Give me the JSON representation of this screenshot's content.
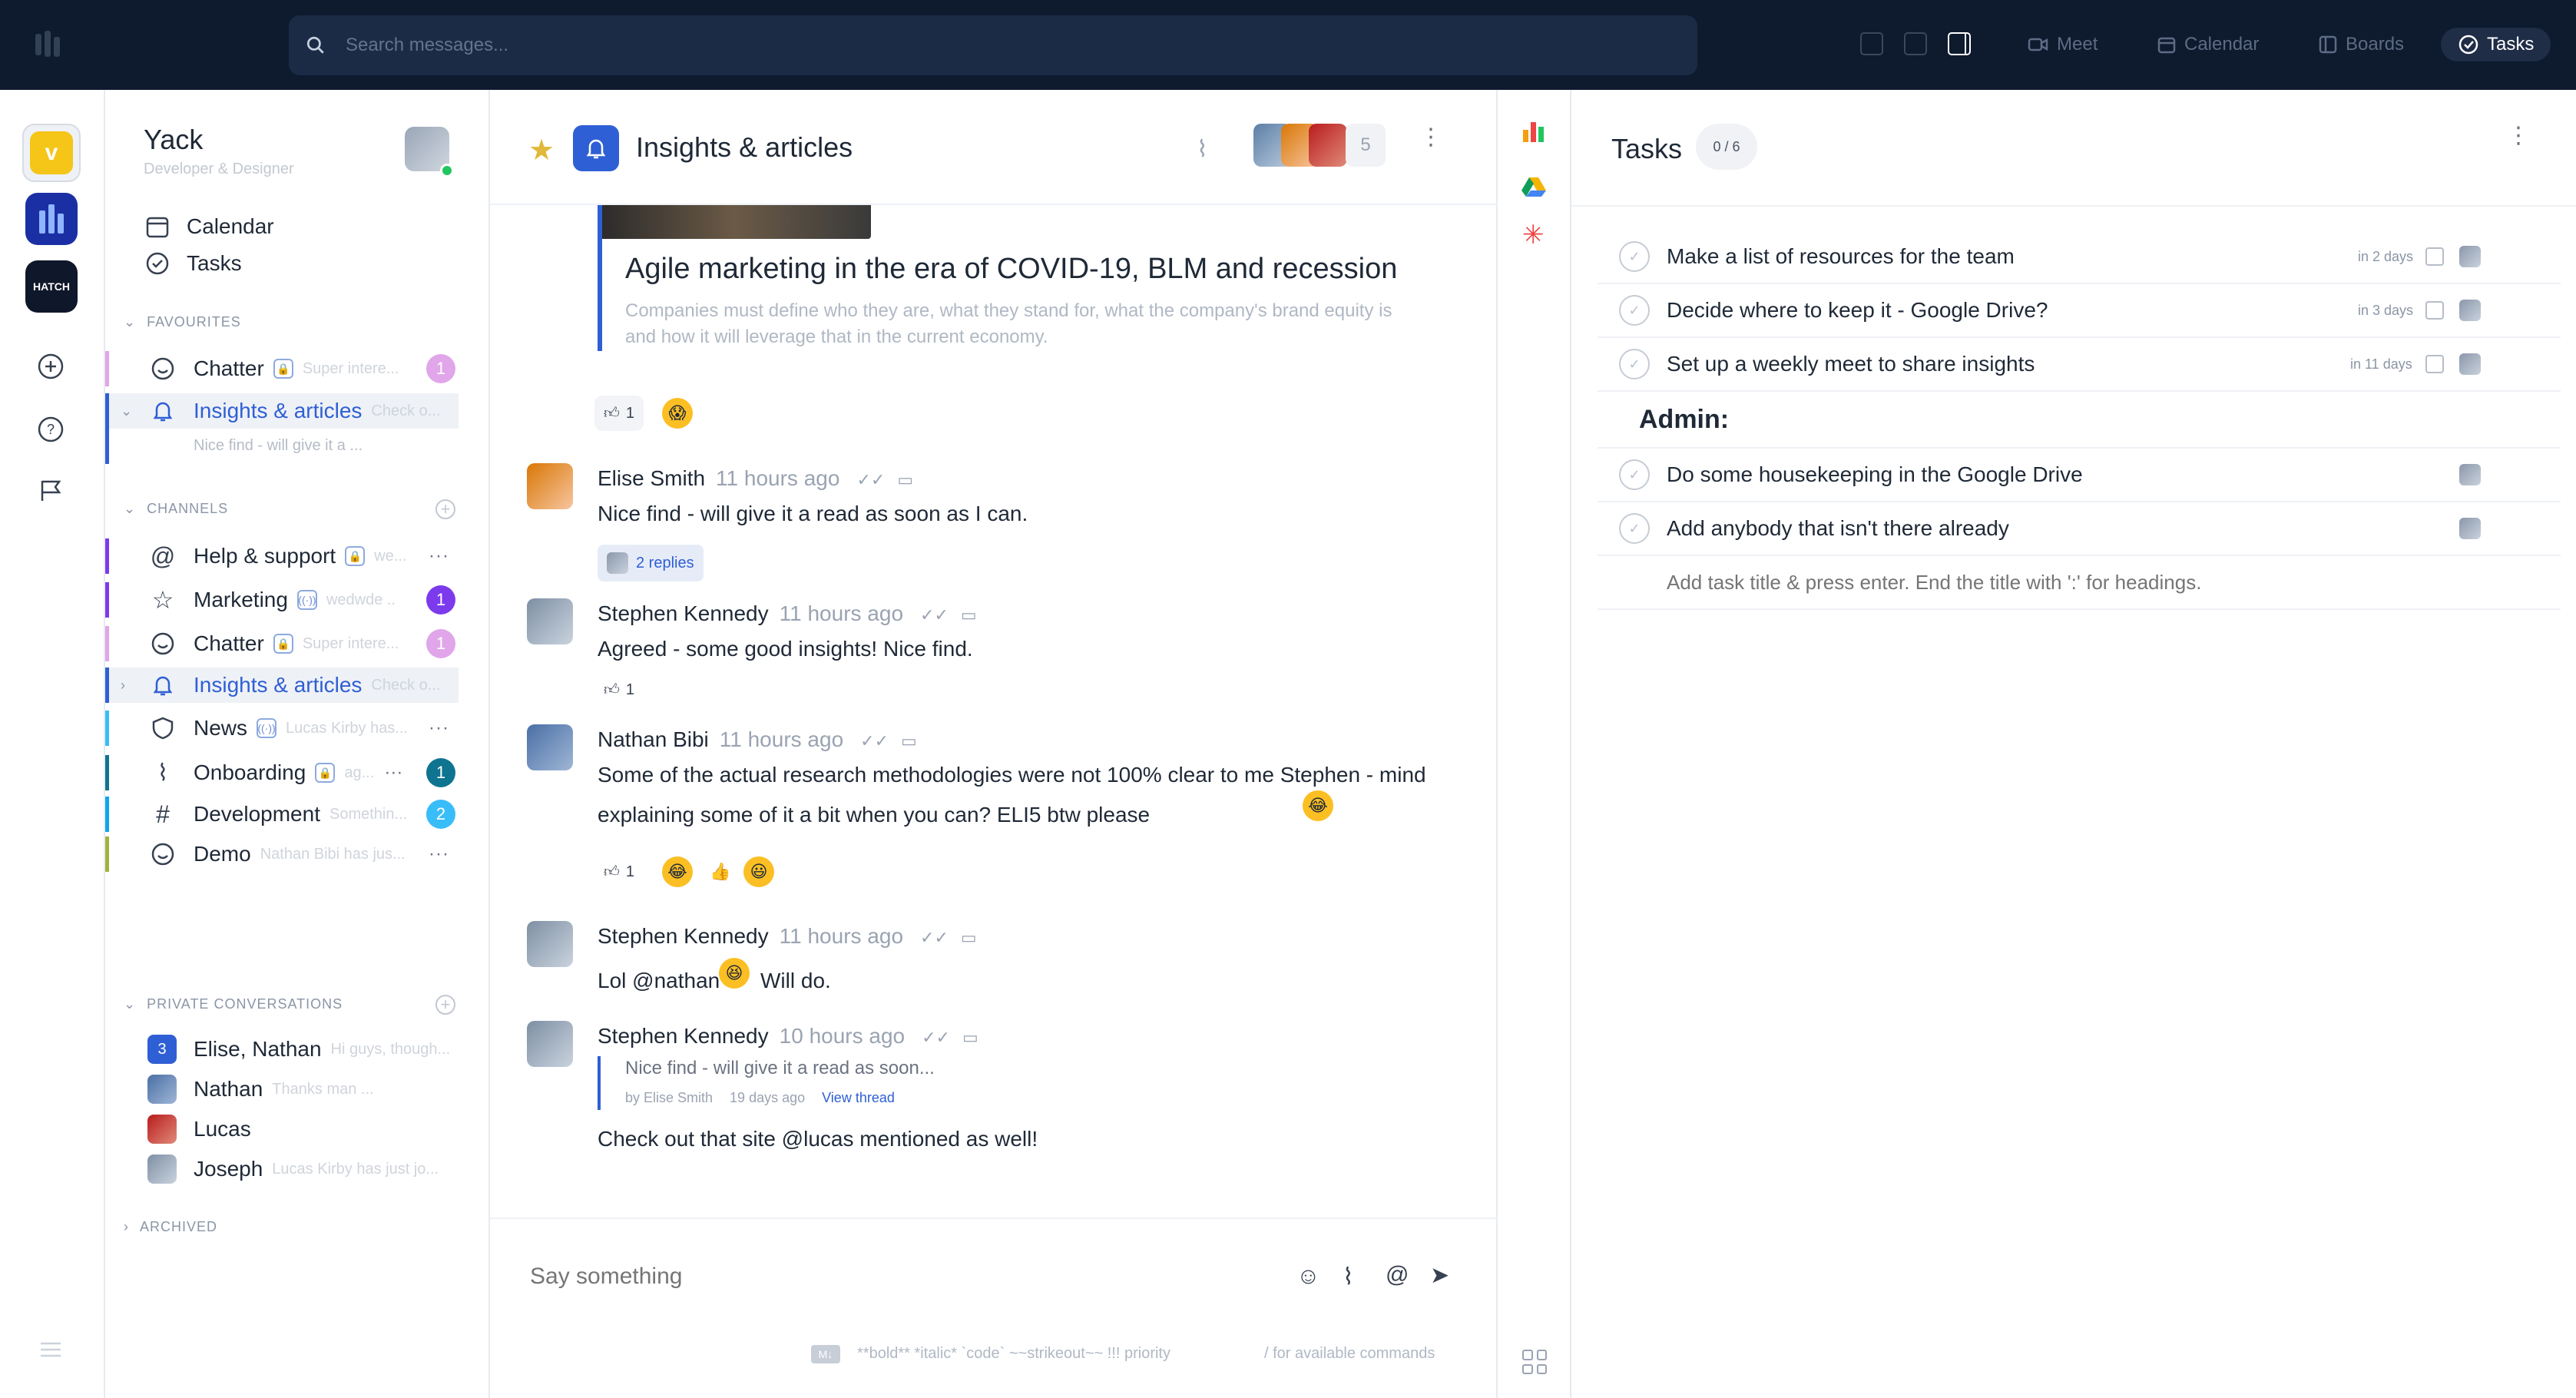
{
  "topbar": {
    "search_placeholder": "Search messages...",
    "nav": [
      {
        "label": "Meet",
        "icon": "video-icon"
      },
      {
        "label": "Calendar",
        "icon": "calendar-icon"
      },
      {
        "label": "Boards",
        "icon": "boards-icon"
      },
      {
        "label": "Tasks",
        "icon": "check-circle-icon",
        "active": true
      }
    ]
  },
  "rail": {
    "workspaces": [
      "Yack",
      "Hatch workspace",
      "HATCH"
    ]
  },
  "sidebar": {
    "team_name": "Yack",
    "subtitle": "Developer & Designer",
    "links": [
      {
        "label": "Calendar"
      },
      {
        "label": "Tasks"
      }
    ],
    "favourites_label": "FAVOURITES",
    "favourites": [
      {
        "name": "Chatter",
        "preview": "Super intere...",
        "badge": "1"
      },
      {
        "name": "Insights & articles",
        "preview": "Check o...",
        "subpreview": "Nice find - will give it a ..."
      }
    ],
    "channels_label": "CHANNELS",
    "channels": [
      {
        "name": "Help & support",
        "preview": "we...",
        "bar": "#7c3aed"
      },
      {
        "name": "Marketing",
        "preview": "wedwde ...",
        "badge": "1",
        "bar": "#7c3aed"
      },
      {
        "name": "Chatter",
        "preview": "Super intere...",
        "badge": "1",
        "bar": "#e0a6e9"
      },
      {
        "name": "Insights & articles",
        "preview": "Check o...",
        "bar": "#2f5fd4"
      },
      {
        "name": "News",
        "preview": "Lucas Kirby has...",
        "bar": "#38bdf8"
      },
      {
        "name": "Onboarding",
        "preview": "ag...",
        "badge": "1",
        "bar": "#0e7490"
      },
      {
        "name": "Development",
        "preview": "Somethin...",
        "badge": "2",
        "bar": "#0ea5e9"
      },
      {
        "name": "Demo",
        "preview": "Nathan Bibi has jus...",
        "bar": "#a3b13c"
      }
    ],
    "private_label": "PRIVATE CONVERSATIONS",
    "private": [
      {
        "name": "Elise, Nathan",
        "preview": "Hi guys, though...",
        "count": "3"
      },
      {
        "name": "Nathan",
        "preview": "Thanks man ..."
      },
      {
        "name": "Lucas",
        "preview": ""
      },
      {
        "name": "Joseph",
        "preview": "Lucas Kirby has just jo..."
      }
    ],
    "archived_label": "ARCHIVED"
  },
  "channel": {
    "title": "Insights & articles",
    "member_count": "5",
    "article_title": "Agile marketing in the era of COVID-19, BLM and recession",
    "article_desc_1": "Companies must define who they are, what they stand for, what the company's brand equity is",
    "article_desc_2": "and how it will leverage that in the current economy.",
    "article_likes": "1"
  },
  "messages": [
    {
      "author": "Elise Smith",
      "time": "11 hours ago",
      "text": "Nice find - will give it a read as soon as I can.",
      "replies": "2 replies"
    },
    {
      "author": "Stephen Kennedy",
      "time": "11 hours ago",
      "text": "Agreed - some good insights! Nice find.",
      "likes": "1"
    },
    {
      "author": "Nathan Bibi",
      "time": "11 hours ago",
      "text_1": "Some of the actual research methodologies were not 100% clear to me Stephen - mind",
      "text_2": "explaining some of it a bit when you can? ELI5 btw please",
      "likes": "1"
    },
    {
      "author": "Stephen Kennedy",
      "time": "11 hours ago",
      "text_a": "Lol @nathan",
      "text_b": "Will do."
    },
    {
      "author": "Stephen Kennedy",
      "time": "10 hours ago",
      "quote": "Nice find - will give it a read as soon...",
      "quote_meta": "by Elise Smith",
      "quote_time": "19 days ago",
      "view_thread": "View thread",
      "text": "Check out that site @lucas mentioned as well!"
    }
  ],
  "composer": {
    "placeholder": "Say something",
    "hint": "**bold** *italic* `code` ~~strikeout~~ !!! priority",
    "commands": "/ for available commands"
  },
  "tasks": {
    "title": "Tasks",
    "count": "0 / 6",
    "items": [
      {
        "title": "Make a list of resources for the team",
        "due": "in 2 days"
      },
      {
        "title": "Decide where to keep it - Google Drive?",
        "due": "in 3 days"
      },
      {
        "title": "Set up a weekly meet to share insights",
        "due": "in 11 days"
      }
    ],
    "heading": "Admin:",
    "admin_items": [
      {
        "title": "Do some housekeeping in the Google Drive"
      },
      {
        "title": "Add anybody that isn't there already"
      }
    ],
    "new_placeholder": "Add task title & press enter. End the title with ':' for headings."
  }
}
